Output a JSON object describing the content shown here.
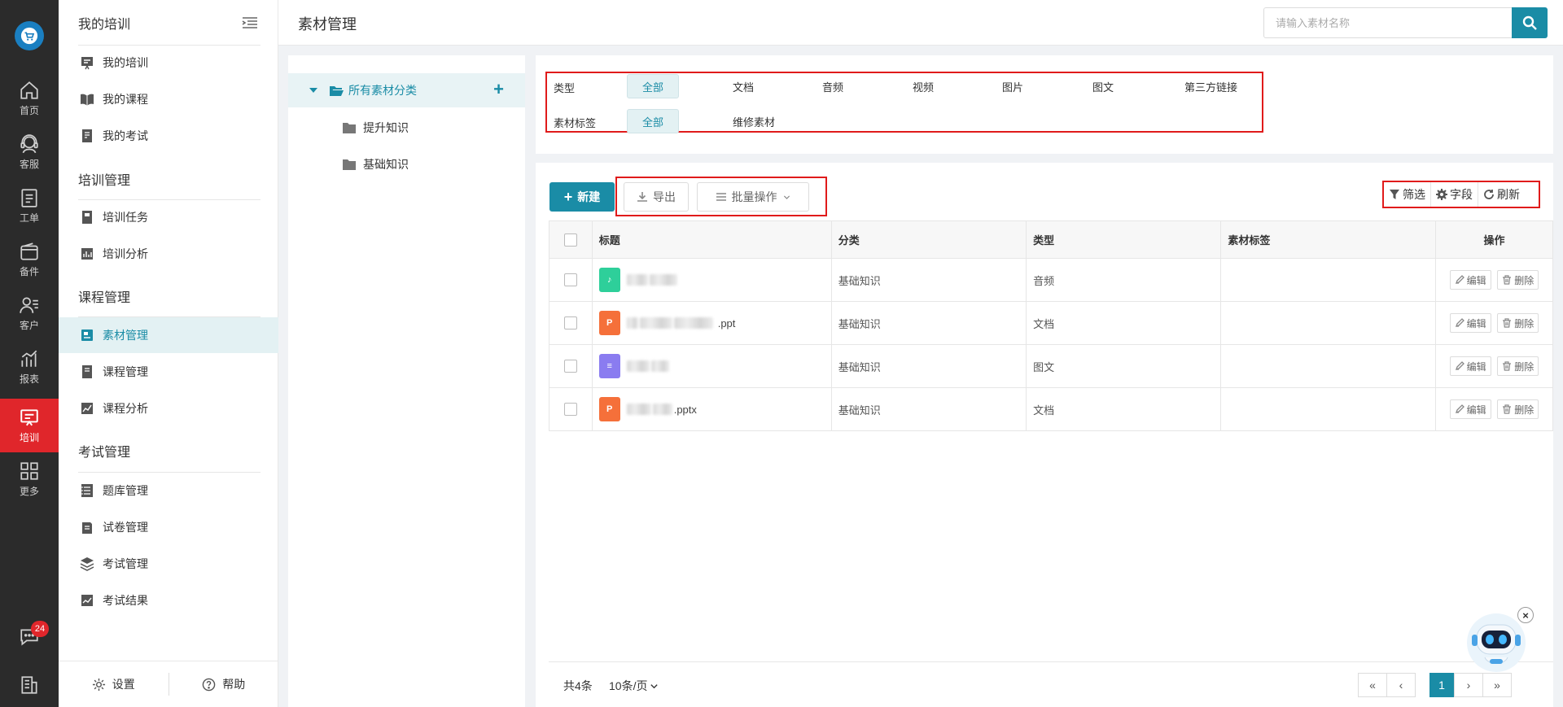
{
  "rail": {
    "items": [
      {
        "label": "首页",
        "icon": "home-icon"
      },
      {
        "label": "客服",
        "icon": "headset-icon"
      },
      {
        "label": "工单",
        "icon": "clipboard-icon"
      },
      {
        "label": "备件",
        "icon": "wallet-icon"
      },
      {
        "label": "客户",
        "icon": "users-icon"
      },
      {
        "label": "报表",
        "icon": "chart-icon"
      },
      {
        "label": "培训",
        "icon": "training-icon"
      },
      {
        "label": "更多",
        "icon": "grid-icon"
      }
    ],
    "message_badge": "24"
  },
  "sidebar": {
    "title": "我的培训",
    "my": [
      "我的培训",
      "我的课程",
      "我的考试"
    ],
    "group_training": "培训管理",
    "training": [
      "培训任务",
      "培训分析"
    ],
    "group_course": "课程管理",
    "course": [
      "素材管理",
      "课程管理",
      "课程分析"
    ],
    "group_exam": "考试管理",
    "exam": [
      "题库管理",
      "试卷管理",
      "考试管理",
      "考试结果"
    ],
    "settings_label": "设置",
    "help_label": "帮助"
  },
  "header": {
    "title": "素材管理",
    "search_placeholder": "请输入素材名称"
  },
  "tree": {
    "root": "所有素材分类",
    "children": [
      "提升知识",
      "基础知识"
    ]
  },
  "filter": {
    "type_label": "类型",
    "type_options": [
      "全部",
      "文档",
      "音频",
      "视频",
      "图片",
      "图文",
      "第三方链接"
    ],
    "tag_label": "素材标签",
    "tag_options": [
      "全部",
      "维修素材"
    ]
  },
  "toolbar": {
    "new_label": "新建",
    "export_label": "导出",
    "batch_label": "批量操作",
    "filter_label": "筛选",
    "fields_label": "字段",
    "refresh_label": "刷新"
  },
  "table": {
    "columns": [
      "标题",
      "分类",
      "类型",
      "素材标签",
      "操作"
    ],
    "rows": [
      {
        "title": "",
        "category": "基础知识",
        "type": "音频",
        "tag": "",
        "icon_color": "#2ecf9a",
        "icon": "music-file-icon"
      },
      {
        "title": ".ppt",
        "category": "基础知识",
        "type": "文档",
        "tag": "",
        "icon_color": "#f5703a",
        "icon": "ppt-file-icon"
      },
      {
        "title": "",
        "category": "基础知识",
        "type": "图文",
        "tag": "",
        "icon_color": "#8a7cf0",
        "icon": "article-file-icon"
      },
      {
        "title": ".pptx",
        "category": "基础知识",
        "type": "文档",
        "tag": "",
        "icon_color": "#f5703a",
        "icon": "ppt-file-icon"
      }
    ],
    "edit_label": "编辑",
    "delete_label": "删除"
  },
  "pager": {
    "total": "共4条",
    "page_size": "10条/页",
    "first": "«",
    "prev": "‹",
    "current": "1",
    "next": "›",
    "last": "»"
  },
  "colors": {
    "accent": "#1a8ca6",
    "rail_active": "#e0262b",
    "highlight_box": "#e01b1b"
  }
}
